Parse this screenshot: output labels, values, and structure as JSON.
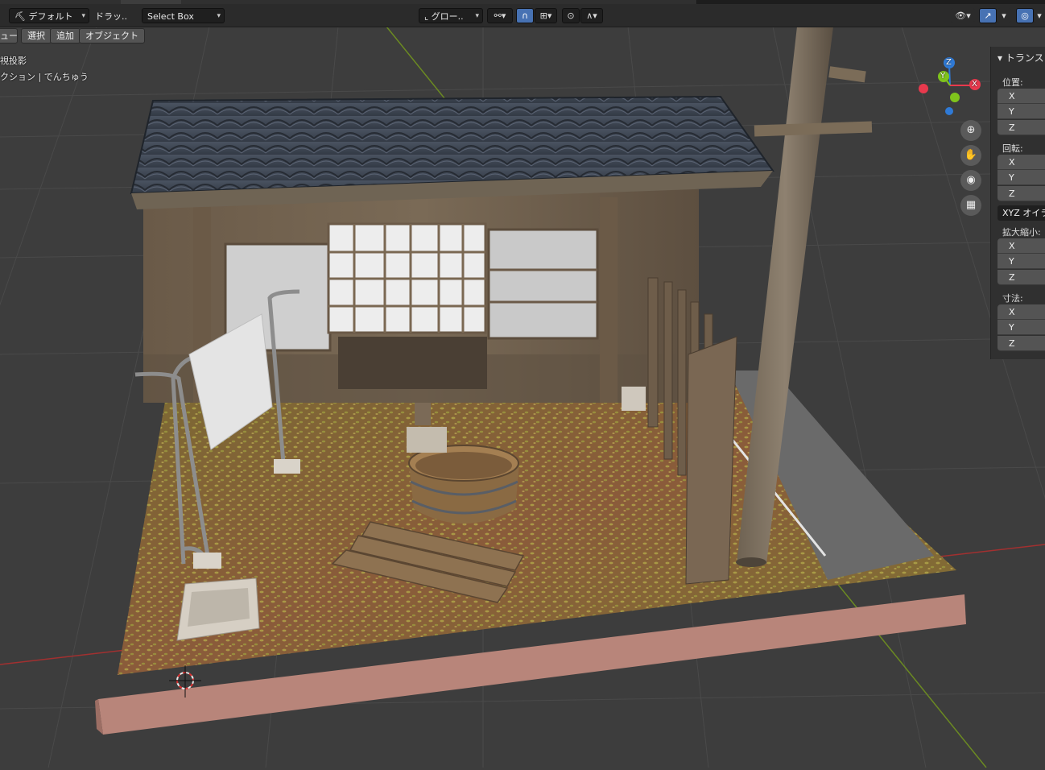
{
  "header": {
    "mode_label": "デフォルト",
    "drag_label": "ドラッ..",
    "select_box": "Select Box",
    "orientation": "グロー..",
    "view_icons": [
      "visibility-icon",
      "gizmo-icon",
      "overlay-icon"
    ]
  },
  "menu": {
    "view": "ュー",
    "select": "選択",
    "add": "追加",
    "object": "オブジェクト"
  },
  "viewport_info": {
    "projection": "視投影",
    "collection": "クション | でんちゅう"
  },
  "gizmo": {
    "z": "Z",
    "y": "Y",
    "x": "X"
  },
  "npanel": {
    "title": "トランス",
    "location": {
      "label": "位置:",
      "fields": [
        "X",
        "Y",
        "Z"
      ]
    },
    "rotation": {
      "label": "回転:",
      "fields": [
        "X",
        "Y",
        "Z"
      ]
    },
    "rotation_mode": "XYZ オイラ",
    "scale": {
      "label": "拡大縮小:",
      "fields": [
        "X",
        "Y",
        "Z"
      ]
    },
    "dimensions": {
      "label": "寸法:",
      "fields": [
        "X",
        "Y",
        "Z"
      ]
    }
  },
  "colors": {
    "accent": "#4772b3",
    "axis_x": "#e8394d",
    "axis_y": "#7fc41c",
    "axis_z": "#2f7ad6"
  }
}
